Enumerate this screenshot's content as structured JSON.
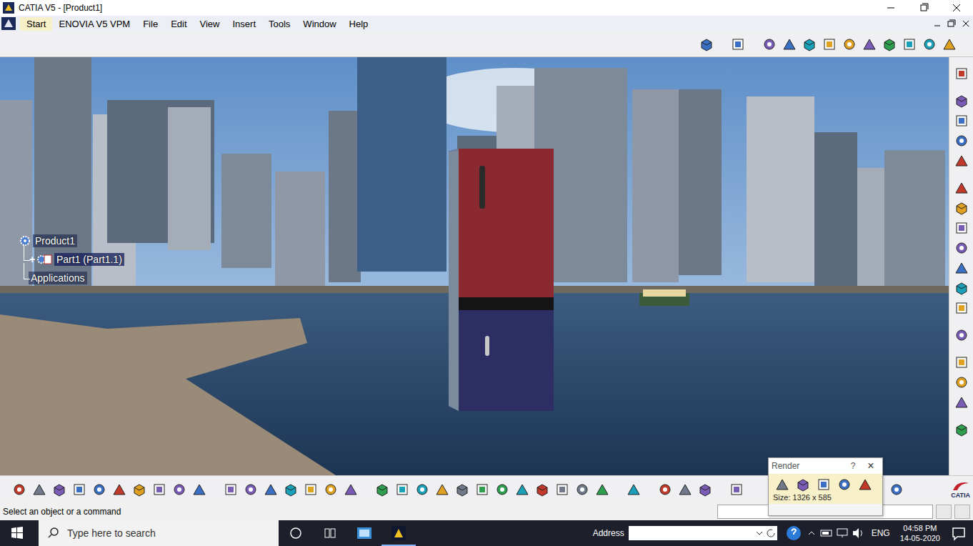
{
  "window": {
    "title": "CATIA V5 - [Product1]"
  },
  "menu": [
    {
      "label": "Start",
      "selected": true
    },
    {
      "label": "ENOVIA V5 VPM",
      "selected": false
    },
    {
      "label": "File",
      "selected": false
    },
    {
      "label": "Edit",
      "selected": false
    },
    {
      "label": "View",
      "selected": false
    },
    {
      "label": "Insert",
      "selected": false
    },
    {
      "label": "Tools",
      "selected": false
    },
    {
      "label": "Window",
      "selected": false
    },
    {
      "label": "Help",
      "selected": false
    }
  ],
  "tree": [
    {
      "label": "Product1",
      "kind": "product",
      "toggle": ""
    },
    {
      "label": "Part1 (Part1.1)",
      "kind": "part",
      "toggle": "+"
    },
    {
      "label": "Applications",
      "kind": "leaf",
      "toggle": ""
    }
  ],
  "status_bar": {
    "message": "Select an object or a command"
  },
  "render_toolbar": {
    "title": "Render",
    "help": "?",
    "close": "×",
    "size": "Size: 1326 x 585"
  },
  "brand": "CATIA",
  "taskbar": {
    "search_placeholder": "Type here to search",
    "address_label": "Address",
    "language": "ENG",
    "time": "04:58 PM",
    "date": "14-05-2020"
  }
}
